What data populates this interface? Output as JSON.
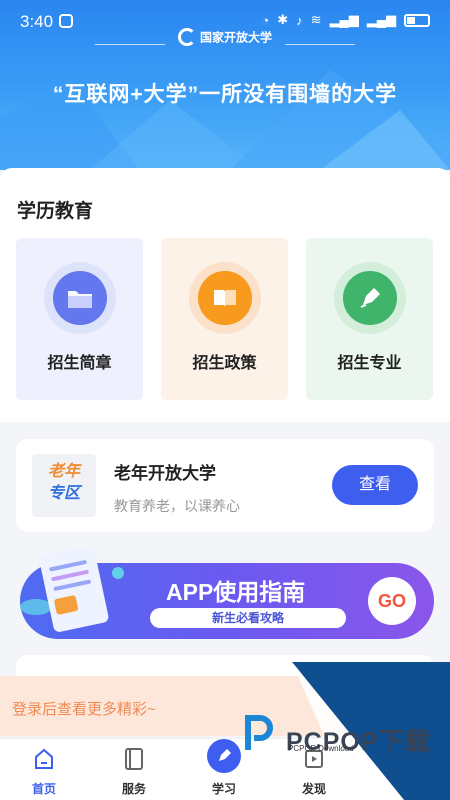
{
  "status_bar": {
    "time": "3:40"
  },
  "banner": {
    "logo_name": "国家开放大学",
    "slogan": "“互联网+大学”一所没有围墙的大学"
  },
  "education": {
    "title": "学历教育",
    "cards": [
      {
        "label": "招生简章",
        "icon": "folder-icon"
      },
      {
        "label": "招生政策",
        "icon": "book-icon"
      },
      {
        "label": "招生专业",
        "icon": "pen-icon"
      }
    ]
  },
  "senior": {
    "badge_line1": "老年",
    "badge_line2": "专区",
    "title": "老年开放大学",
    "subtitle": "教育养老，以课养心",
    "button": "查看"
  },
  "guide": {
    "title": "APP使用指南",
    "pill": "新生必看攻略",
    "go": "GO"
  },
  "login_prompt": "登录后查看更多精彩~",
  "tabbar": [
    {
      "label": "首页",
      "icon": "home-icon",
      "active": true
    },
    {
      "label": "服务",
      "icon": "service-icon",
      "active": false
    },
    {
      "label": "学习",
      "icon": "study-icon",
      "active": false
    },
    {
      "label": "发现",
      "icon": "discover-icon",
      "active": false
    }
  ],
  "watermark": {
    "text": "PCPOP下载",
    "sub": "PCPOP Download"
  },
  "colors": {
    "accent": "#3e5ef0",
    "banner": "#2a86f0",
    "login_bg": "#fde7da"
  }
}
